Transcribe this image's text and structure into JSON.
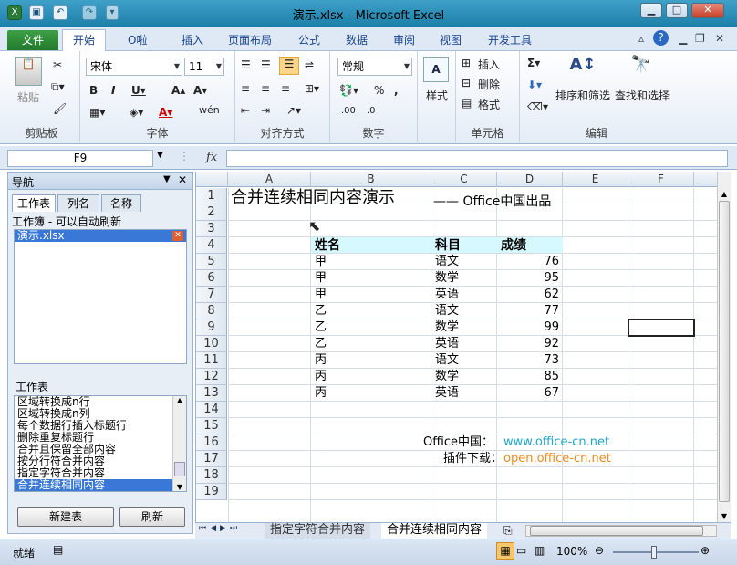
{
  "window": {
    "title": "演示.xlsx - Microsoft Excel"
  },
  "ribbon_tabs": [
    "文件",
    "开始",
    "O啦",
    "插入",
    "页面布局",
    "公式",
    "数据",
    "审阅",
    "视图",
    "开发工具"
  ],
  "ribbon": {
    "clipboard": {
      "paste": "粘贴",
      "label": "剪贴板"
    },
    "font": {
      "name": "宋体",
      "size": "11",
      "label": "字体"
    },
    "align": {
      "label": "对齐方式"
    },
    "number": {
      "format": "常规",
      "label": "数字"
    },
    "styles": {
      "label": "样式"
    },
    "cells": {
      "insert": "插入",
      "delete": "删除",
      "format": "格式",
      "label": "单元格"
    },
    "editing": {
      "sort": "排序和筛选",
      "find": "查找和选择",
      "label": "编辑"
    }
  },
  "formula_bar": {
    "name_box": "F9",
    "fx": "fx",
    "value": ""
  },
  "nav": {
    "title": "导航",
    "tabs": [
      "工作表",
      "列名",
      "名称"
    ],
    "workbook_label": "工作簿 - 可以自动刷新",
    "workbooks": [
      "演示.xlsx"
    ],
    "sheets_label": "工作表",
    "sheets": [
      "区域转换成n行",
      "区域转换成n列",
      "每个数据行插入标题行",
      "删除重复标题行",
      "合并且保留全部内容",
      "按分行符合并内容",
      "指定字符合并内容",
      "合并连续相同内容"
    ],
    "selected_sheet": 7,
    "new_button": "新建表",
    "refresh_button": "刷新"
  },
  "grid": {
    "columns": [
      "A",
      "B",
      "C",
      "D",
      "E",
      "F"
    ],
    "rows": [
      "1",
      "2",
      "3",
      "4",
      "5",
      "6",
      "7",
      "8",
      "9",
      "10",
      "11",
      "12",
      "13",
      "14",
      "15",
      "16",
      "17",
      "18",
      "19"
    ],
    "title": "合并连续相同内容演示",
    "credit": "—— Office中国出品",
    "headers": [
      "姓名",
      "科目",
      "成绩"
    ],
    "data": [
      [
        "甲",
        "语文",
        "76"
      ],
      [
        "甲",
        "数学",
        "95"
      ],
      [
        "甲",
        "英语",
        "62"
      ],
      [
        "乙",
        "语文",
        "77"
      ],
      [
        "乙",
        "数学",
        "99"
      ],
      [
        "乙",
        "英语",
        "92"
      ],
      [
        "丙",
        "语文",
        "73"
      ],
      [
        "丙",
        "数学",
        "85"
      ],
      [
        "丙",
        "英语",
        "67"
      ]
    ],
    "site_label": "Office中国：",
    "site_url": "www.office-cn.net",
    "plugin_label": "插件下载：",
    "plugin_url": "open.office-cn.net",
    "header_fill": "#d6f8ff",
    "site_color": "#1fa7c8",
    "plugin_color": "#f08a1c"
  },
  "sheet_tabs": [
    "指定字符合并内容",
    "合并连续相同内容"
  ],
  "status": {
    "ready": "就绪",
    "zoom": "100%"
  }
}
